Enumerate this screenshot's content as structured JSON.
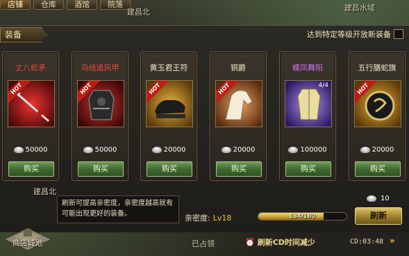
{
  "top_tabs": [
    {
      "label": "店铺",
      "active": true
    },
    {
      "label": "仓库",
      "active": false
    },
    {
      "label": "酒馆",
      "active": false
    },
    {
      "label": "院落",
      "active": false
    }
  ],
  "map_labels": [
    "建昌北",
    "建昌水域",
    "建昌北"
  ],
  "header": {
    "equip_tab": "装备",
    "notice": "达到特定等级开放新装备"
  },
  "items": [
    {
      "name": "丈八蛇矛",
      "name_color": "#e84a3c",
      "hot": "HOT",
      "stars": "☆☆",
      "price": "50000",
      "buy": "购买",
      "count": ""
    },
    {
      "name": "乌线追风甲",
      "name_color": "#e84a3c",
      "hot": "HOT",
      "stars": "☆☆",
      "price": "50000",
      "buy": "购买",
      "count": ""
    },
    {
      "name": "黄玉君王符",
      "name_color": "#f0e6c8",
      "hot": "HOT",
      "stars": "",
      "price": "20000",
      "buy": "购买",
      "count": ""
    },
    {
      "name": "铜爵",
      "name_color": "#f0e6c8",
      "hot": "HOT",
      "stars": "☆☆",
      "price": "20000",
      "buy": "购买",
      "count": ""
    },
    {
      "name": "蝶凤舞阳",
      "name_color": "#d070f0",
      "hot": "",
      "stars": "☆☆",
      "price": "100000",
      "buy": "购买",
      "count": "4/4"
    },
    {
      "name": "五行膳蛇旗",
      "name_color": "#f0e6c8",
      "hot": "HOT",
      "stars": "☆☆",
      "price": "20000",
      "buy": "购买",
      "count": ""
    }
  ],
  "footer": {
    "tooltip": "刷新可提高亲密度，亲密度越高就有可能出现更好的装备。",
    "intimacy_label": "亲密度:",
    "intimacy_level": "Lv18",
    "progress_text": "134/180",
    "progress_fraction": 0.744,
    "refresh_cost": "10",
    "refresh_button": "刷新",
    "city_label": "商店城池",
    "occupied": "已占领",
    "cd_reduce": "刷新CD时间减少",
    "cd_timer": "CD:03:48",
    "arrows": "»"
  },
  "colors": {
    "buy_button": "#3f6b2f",
    "refresh_button": "#a5862e",
    "hot_ribbon": "#c01c12",
    "panel": "#24221e"
  }
}
